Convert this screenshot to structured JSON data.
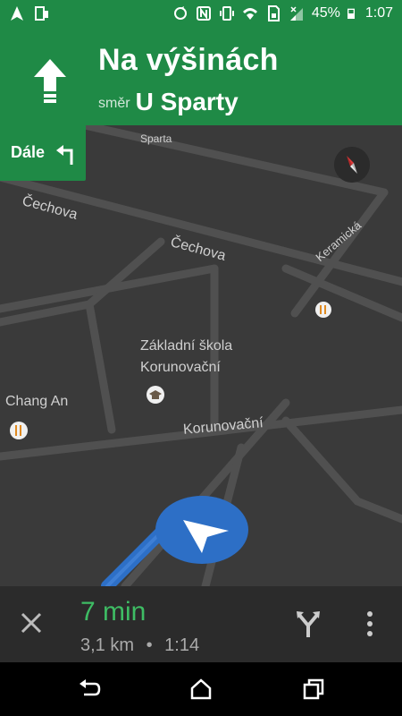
{
  "status_bar": {
    "battery_percent": "45%",
    "time": "1:07",
    "icons": [
      "navigation-icon",
      "screen-mirror-icon",
      "sync-icon",
      "nfc-icon",
      "vibrate-icon",
      "wifi-icon",
      "sim-icon",
      "signal-icon",
      "battery-icon"
    ]
  },
  "nav": {
    "street": "Na výšinách",
    "direction_prefix": "směr",
    "direction": "U Sparty",
    "then_label": "Dále"
  },
  "map": {
    "labels": {
      "sparta": "Sparta",
      "cechova_1": "Čechova",
      "cechova_2": "Čechova",
      "keramicka": "Keramická",
      "school_line1": "Základní škola",
      "school_line2": "Korunovační",
      "chang_an": "Chang An",
      "korunovacni": "Korunovační"
    },
    "poi_icons": [
      "restaurant-icon",
      "school-icon",
      "restaurant-icon"
    ],
    "route_color": "#2d6fc6",
    "road_color": "#505050"
  },
  "trip": {
    "eta": "7 min",
    "distance": "3,1 km",
    "separator": "•",
    "arrival": "1:14",
    "eta_color": "#3ebd64"
  },
  "colors": {
    "accent_green": "#1f8a46",
    "map_bg": "#3a3a3a",
    "bottom_bg": "#2b2b2b"
  }
}
